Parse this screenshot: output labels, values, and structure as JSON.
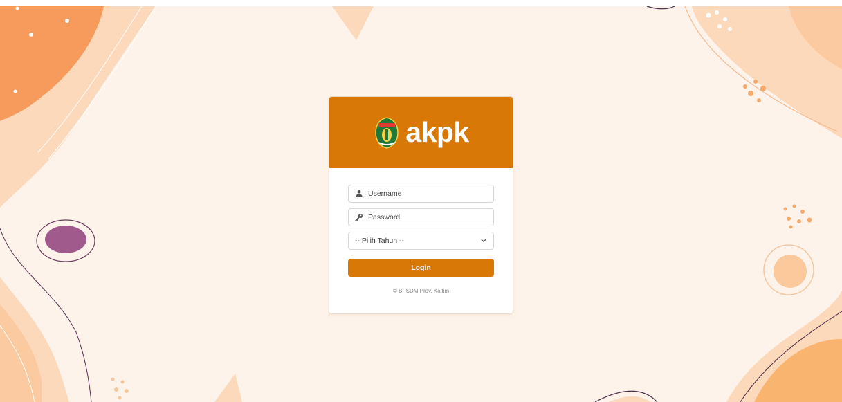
{
  "brand": {
    "name": "akpk",
    "logo_icon": "kaltim-emblem-icon"
  },
  "form": {
    "username": {
      "placeholder": "Username",
      "value": "",
      "icon": "user-icon"
    },
    "password": {
      "placeholder": "Password",
      "value": "",
      "icon": "key-icon"
    },
    "year_select": {
      "selected": "-- Pilih Tahun --",
      "icon": "chevron-down-icon"
    },
    "login_label": "Login"
  },
  "footer": {
    "text": "© BPSDM Prov. Kaltim"
  },
  "colors": {
    "accent": "#d87807",
    "background": "#fdf3ea",
    "peach": "#fbd4b0",
    "orange": "#f79b5c",
    "purple": "#a05a8c"
  }
}
